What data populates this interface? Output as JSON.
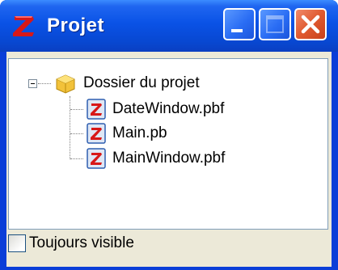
{
  "window": {
    "title": "Projet",
    "icon": "purebasic-z-icon"
  },
  "title_buttons": {
    "minimize": "minimize-icon",
    "maximize": "maximize-icon",
    "close": "close-icon"
  },
  "tree": {
    "root": {
      "label": "Dossier du projet",
      "icon": "folder-icon",
      "expanded": true
    },
    "files": [
      {
        "label": "DateWindow.pbf",
        "icon": "pb-file-icon"
      },
      {
        "label": "Main.pb",
        "icon": "pb-file-icon"
      },
      {
        "label": "MainWindow.pbf",
        "icon": "pb-file-icon"
      }
    ]
  },
  "options": {
    "always_visible_label": "Toujours visible",
    "always_visible_checked": false
  },
  "colors": {
    "titlebar": "#0a52e6",
    "client": "#ece9d8",
    "close_button": "#e05a30"
  }
}
